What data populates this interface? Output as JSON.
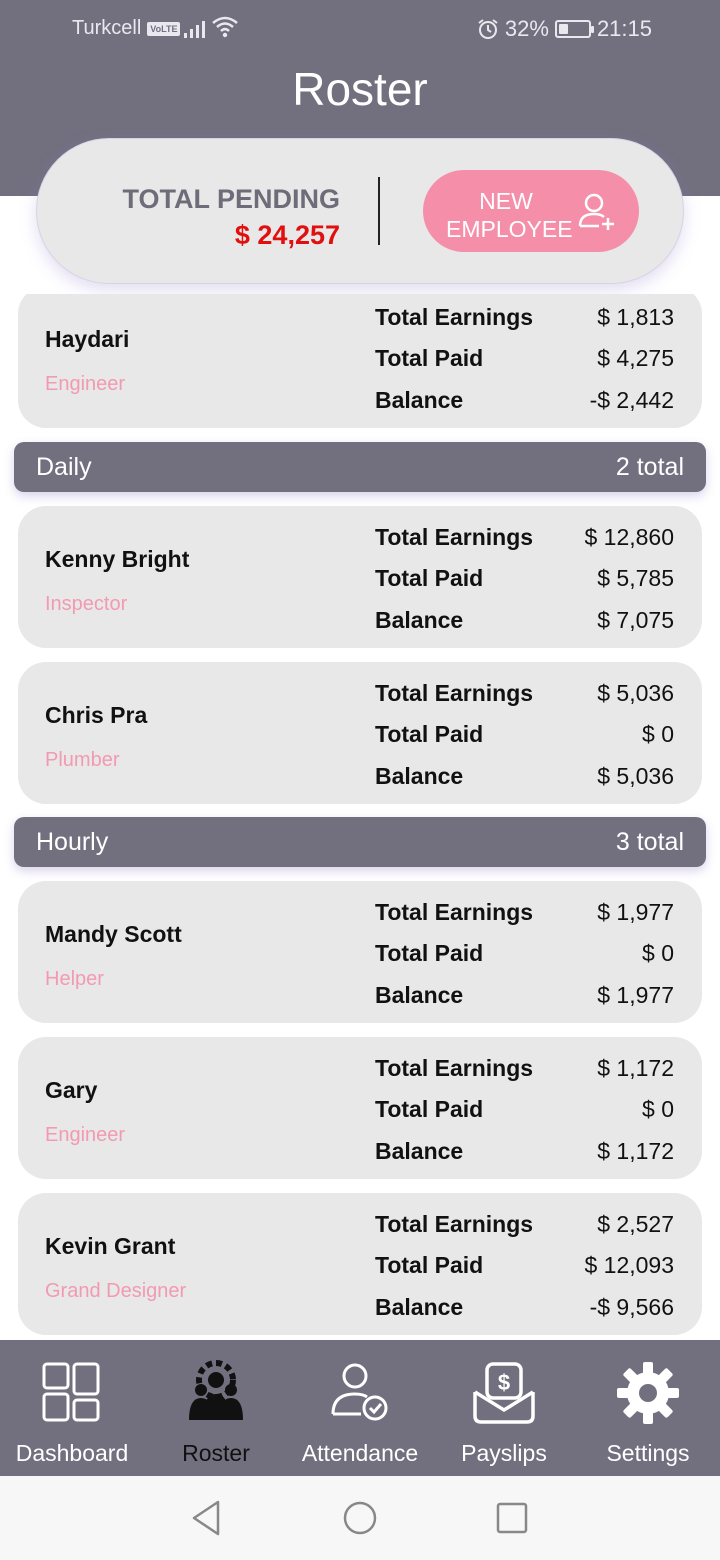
{
  "status_bar": {
    "carrier": "Turkcell",
    "network_badge": "VoLTE",
    "battery_percent": "32%",
    "battery_level": 0.32,
    "time": "21:15"
  },
  "header": {
    "title": "Roster"
  },
  "summary": {
    "pending_label": "TOTAL PENDING",
    "pending_amount": "$ 24,257",
    "new_employee_line1": "NEW",
    "new_employee_line2": "EMPLOYEE",
    "new_employee_icon": "add-user-icon"
  },
  "row_labels": {
    "earnings": "Total Earnings",
    "paid": "Total Paid",
    "balance": "Balance"
  },
  "employees_top": [
    {
      "name": "Haydari",
      "role": "Engineer",
      "earnings": "$ 1,813",
      "paid": "$ 4,275",
      "balance": "-$ 2,442"
    }
  ],
  "sections": [
    {
      "title": "Daily",
      "count": "2 total",
      "employees": [
        {
          "name": "Kenny Bright",
          "role": "Inspector",
          "earnings": "$ 12,860",
          "paid": "$ 5,785",
          "balance": "$ 7,075"
        },
        {
          "name": "Chris Pra",
          "role": "Plumber",
          "earnings": "$ 5,036",
          "paid": "$ 0",
          "balance": "$ 5,036"
        }
      ]
    },
    {
      "title": "Hourly",
      "count": "3 total",
      "employees": [
        {
          "name": "Mandy Scott",
          "role": "Helper",
          "earnings": "$ 1,977",
          "paid": "$ 0",
          "balance": "$ 1,977"
        },
        {
          "name": "Gary",
          "role": "Engineer",
          "earnings": "$ 1,172",
          "paid": "$ 0",
          "balance": "$ 1,172"
        },
        {
          "name": "Kevin Grant",
          "role": "Grand Designer",
          "earnings": "$ 2,527",
          "paid": "$ 12,093",
          "balance": "-$ 9,566"
        }
      ]
    }
  ],
  "bottom_nav": [
    {
      "label": "Dashboard",
      "icon": "dashboard-icon",
      "active": false
    },
    {
      "label": "Roster",
      "icon": "roster-icon",
      "active": true
    },
    {
      "label": "Attendance",
      "icon": "attendance-icon",
      "active": false
    },
    {
      "label": "Payslips",
      "icon": "payslips-icon",
      "active": false
    },
    {
      "label": "Settings",
      "icon": "settings-icon",
      "active": false
    }
  ],
  "colors": {
    "header": "#72707f",
    "card": "#e8e8e8",
    "accent_pink": "#f58fa9",
    "role_pink": "#f29ab2",
    "pending_red": "#e20f0f"
  }
}
